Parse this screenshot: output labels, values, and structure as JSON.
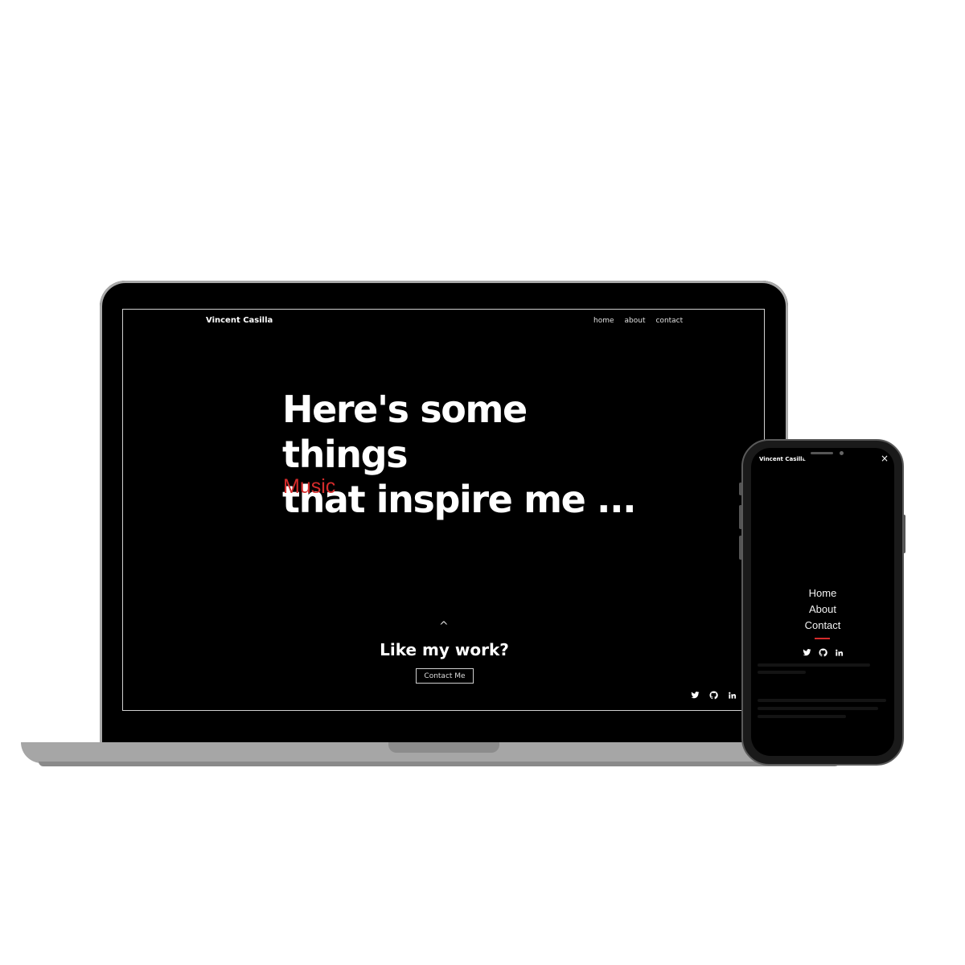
{
  "site": {
    "brand": "Vincent Casilla",
    "nav": [
      {
        "label": "home"
      },
      {
        "label": "about"
      },
      {
        "label": "contact"
      }
    ],
    "headline_line1": "Here's some things",
    "headline_line2": "that inspire me ...",
    "rotating_word": "Music",
    "cta_title": "Like my work?",
    "cta_button": "Contact Me",
    "up_arrow": "^",
    "socials": [
      "twitter-icon",
      "github-icon",
      "linkedin-icon"
    ],
    "accent_color": "#d42b2b",
    "background_color": "#000000",
    "text_color": "#ffffff"
  },
  "phone": {
    "brand": "Vincent Casilla",
    "close": "×",
    "menu": [
      {
        "label": "Home"
      },
      {
        "label": "About"
      },
      {
        "label": "Contact"
      }
    ],
    "socials": [
      "twitter-icon",
      "github-icon",
      "linkedin-icon"
    ]
  }
}
